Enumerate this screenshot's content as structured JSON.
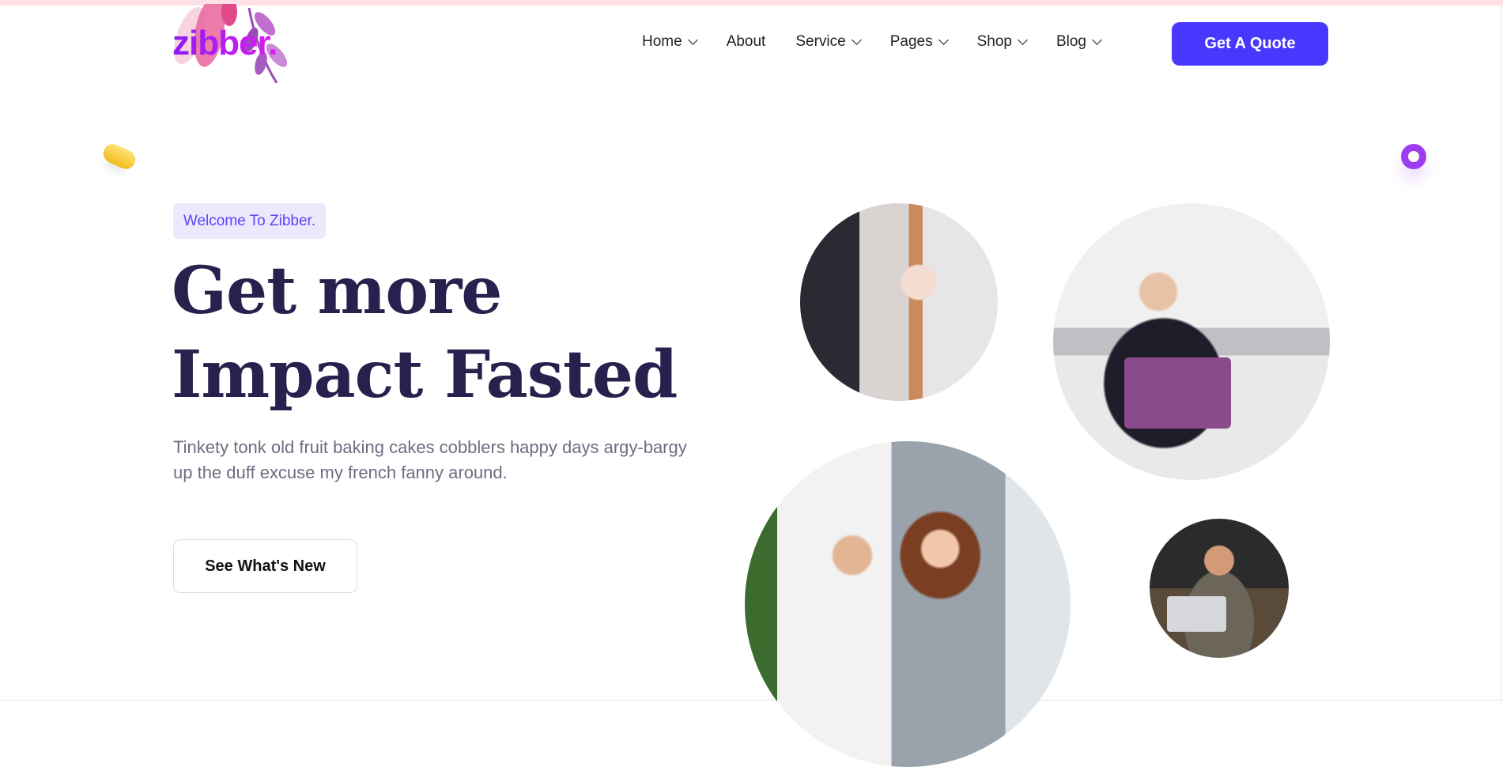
{
  "brand": {
    "logo": "zibber."
  },
  "nav": {
    "items": [
      {
        "label": "Home",
        "dropdown": true
      },
      {
        "label": "About",
        "dropdown": false
      },
      {
        "label": "Service",
        "dropdown": true
      },
      {
        "label": "Pages",
        "dropdown": true
      },
      {
        "label": "Shop",
        "dropdown": true
      },
      {
        "label": "Blog",
        "dropdown": true
      }
    ],
    "cta": "Get A Quote"
  },
  "hero": {
    "badge": "Welcome To Zibber.",
    "title_line1": "Get more",
    "title_line2": "Impact Fasted",
    "description": "Tinkety tonk old fruit baking cakes cobblers happy days argy-bargy up the duff excuse my french fanny around.",
    "button": "See What's New"
  },
  "colors": {
    "accent": "#4838fd",
    "heading": "#27214d",
    "badge_bg": "#ece9fd"
  }
}
